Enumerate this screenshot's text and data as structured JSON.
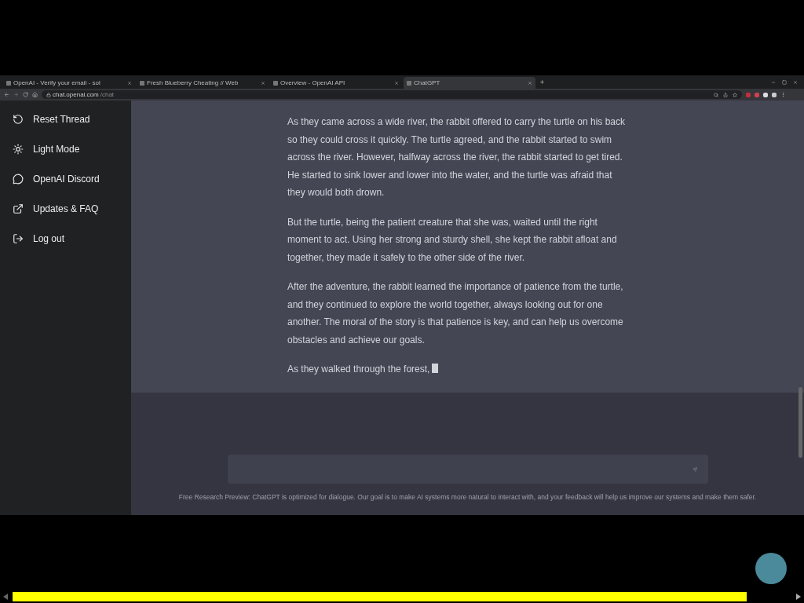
{
  "browser": {
    "tabs": [
      {
        "title": "OpenAI - Verify your email - sol",
        "selected": false
      },
      {
        "title": "Fresh Blueberry Cheating // Web",
        "selected": false
      },
      {
        "title": "Overview - OpenAI API",
        "selected": false
      },
      {
        "title": "ChatGPT",
        "selected": true
      }
    ],
    "url": "chat.openai.com",
    "url_path": "/chat"
  },
  "sidebar": {
    "items": [
      {
        "label": "Reset Thread",
        "kind": "reset"
      },
      {
        "label": "Light Mode",
        "kind": "theme"
      },
      {
        "label": "OpenAI Discord",
        "kind": "community"
      },
      {
        "label": "Updates & FAQ",
        "kind": "link"
      },
      {
        "label": "Log out",
        "kind": "logout"
      }
    ]
  },
  "response": {
    "paragraphs": [
      "As they came across a wide river, the rabbit offered to carry the turtle on his back so they could cross it quickly. The turtle agreed, and the rabbit started to swim across the river. However, halfway across the river, the rabbit started to get tired. He started to sink lower and lower into the water, and the turtle was afraid that they would both drown.",
      "But the turtle, being the patient creature that she was, waited until the right moment to act. Using her strong and sturdy shell, she kept the rabbit afloat and together, they made it safely to the other side of the river.",
      "After the adventure, the rabbit learned the importance of patience from the turtle, and they continued to explore the world together, always looking out for one another. The moral of the story is that patience is key, and can help us overcome obstacles and achieve our goals.",
      "As they walked through the forest,"
    ],
    "typing": true
  },
  "footer": "Free Research Preview: ChatGPT is optimized for dialogue. Our goal is to make AI systems more natural to interact with, and your feedback will help us improve our systems and make them safer."
}
